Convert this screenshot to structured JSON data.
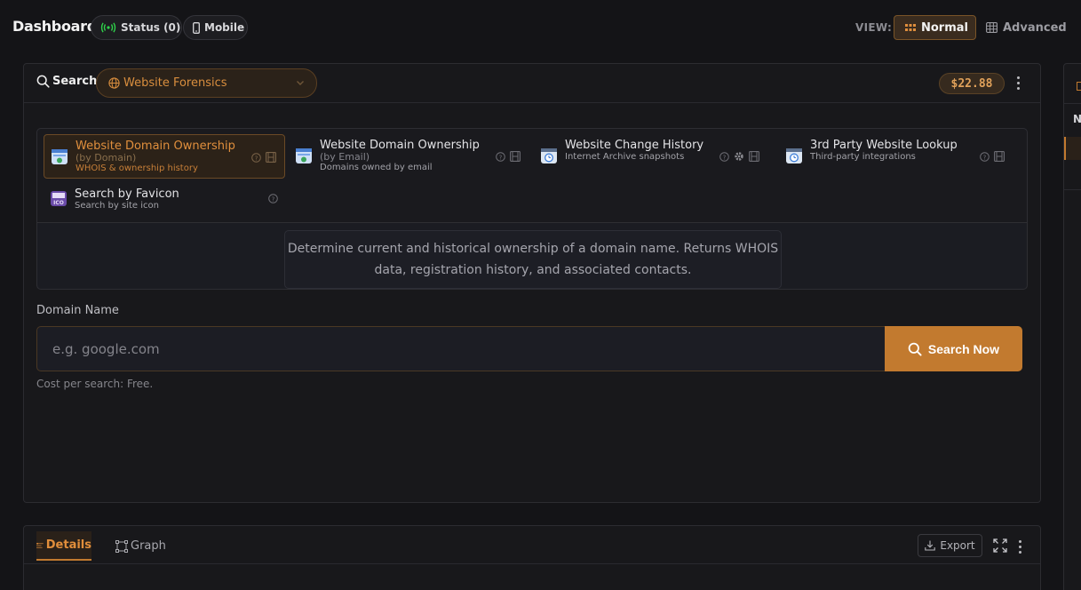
{
  "topbar": {
    "title": "Dashboard",
    "status_label": "Status (0)",
    "mobile_label": "Mobile",
    "view_label": "VIEW:",
    "view_normal": "Normal",
    "view_advanced": "Advanced"
  },
  "search_panel": {
    "search_label": "Search",
    "category": "Website Forensics",
    "price": "$22.88",
    "tools": [
      {
        "name": "Website Domain Ownership",
        "sub": "(by Domain)",
        "desc": "WHOIS & ownership history",
        "active": true
      },
      {
        "name": "Website Domain Ownership",
        "sub": "(by Email)",
        "desc": "Domains owned by email",
        "active": false
      },
      {
        "name": "Website Change History",
        "sub": "",
        "desc": "Internet Archive snapshots",
        "active": false
      },
      {
        "name": "3rd Party Website Lookup",
        "sub": "",
        "desc": "Third-party integrations",
        "active": false
      },
      {
        "name": "Search by Favicon",
        "sub": "",
        "desc": "Search by site icon",
        "active": false
      }
    ],
    "tool_description": "Determine current and historical ownership of a domain name. Returns WHOIS data, registration history, and associated contacts.",
    "field_label": "Domain Name",
    "input_placeholder": "e.g. google.com",
    "input_value": "",
    "search_button": "Search Now",
    "cost_text": "Cost per search: Free."
  },
  "results_panel": {
    "tab_details": "Details",
    "tab_graph": "Graph",
    "export_label": "Export"
  },
  "side_panel": {
    "letter": "N"
  },
  "colors": {
    "accent": "#c27a2f",
    "accent_text": "#e08f3d",
    "background": "#141417",
    "panel": "#18181b",
    "status_green": "#2fd14a"
  }
}
